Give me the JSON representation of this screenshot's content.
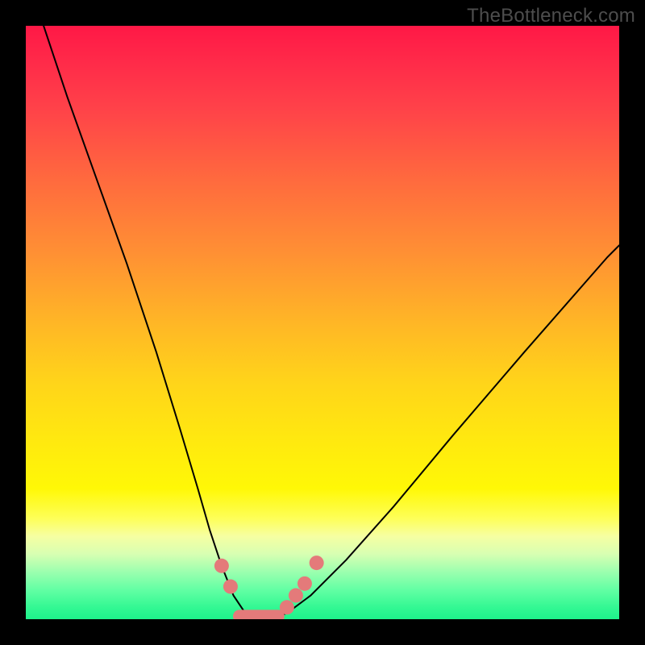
{
  "watermark": "TheBottleneck.com",
  "chart_data": {
    "type": "line",
    "title": "",
    "xlabel": "",
    "ylabel": "",
    "xlim": [
      0,
      100
    ],
    "ylim": [
      0,
      100
    ],
    "series": [
      {
        "name": "bottleneck-curve",
        "x": [
          3,
          7,
          12,
          17,
          22,
          26,
          29,
          31,
          33,
          35,
          37,
          39,
          41,
          44,
          48,
          54,
          62,
          72,
          84,
          98,
          100
        ],
        "y": [
          100,
          88,
          74,
          60,
          45,
          32,
          22,
          15,
          9,
          4,
          1,
          0,
          0,
          1,
          4,
          10,
          19,
          31,
          45,
          61,
          63
        ]
      }
    ],
    "markers": [
      {
        "name": "left-dot-1",
        "x": 33.0,
        "y": 9.0
      },
      {
        "name": "left-dot-2",
        "x": 34.5,
        "y": 5.5
      },
      {
        "name": "right-dot-1",
        "x": 44.0,
        "y": 2.0
      },
      {
        "name": "right-dot-2",
        "x": 45.5,
        "y": 4.0
      },
      {
        "name": "right-dot-3",
        "x": 47.0,
        "y": 6.0
      },
      {
        "name": "right-dot-4",
        "x": 49.0,
        "y": 9.5
      }
    ],
    "flat_segment": {
      "x0": 36.0,
      "x1": 42.5,
      "y": 0.5
    },
    "gradient_stops": [
      {
        "pos": 0,
        "color": "#ff1846"
      },
      {
        "pos": 50,
        "color": "#ffb626"
      },
      {
        "pos": 80,
        "color": "#feff58"
      },
      {
        "pos": 100,
        "color": "#1ef28b"
      }
    ]
  }
}
